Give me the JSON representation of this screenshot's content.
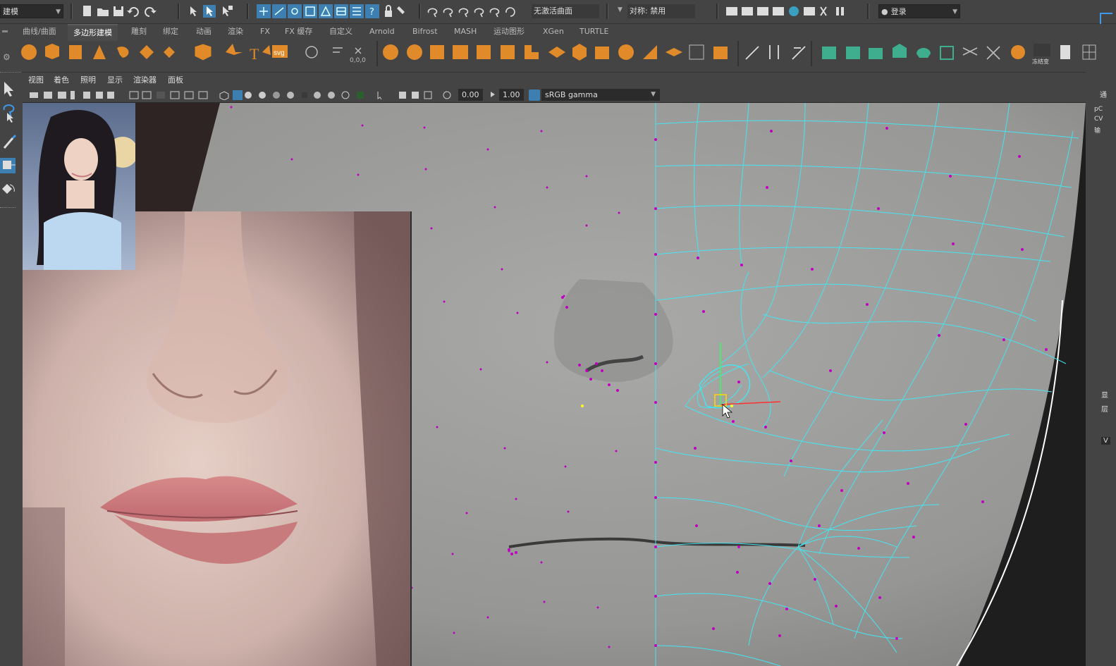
{
  "statusline": {
    "mode": "建模",
    "curve_status": "无激活曲面",
    "symmetry": "对称: 禁用",
    "login": "登录"
  },
  "shelf_tabs": [
    "曲线/曲面",
    "多边形建模",
    "雕刻",
    "绑定",
    "动画",
    "渲染",
    "FX",
    "FX 缓存",
    "自定义",
    "Arnold",
    "Bifrost",
    "MASH",
    "运动图形",
    "XGen",
    "TURTLE"
  ],
  "active_tab_index": 1,
  "shelf": {
    "text_icon": "T",
    "svg_icon": "svg",
    "extra_label": "冻结变"
  },
  "panel_menus": [
    "视图",
    "着色",
    "照明",
    "显示",
    "渲染器",
    "面板"
  ],
  "panel_toolbar": {
    "exposure": "0.00",
    "gamma": "1.00",
    "color_space": "sRGB gamma"
  },
  "right_panel": {
    "labels": [
      "通",
      "pC",
      "CV",
      "输",
      "显",
      "层",
      "V"
    ]
  },
  "icons": {
    "select_tool": "select-arrow-icon",
    "lasso_tool": "lasso-icon",
    "paint_tool": "paint-brush-icon",
    "move_tool": "move-tool-icon",
    "rotate_tool": "rotate-tool-icon"
  },
  "colors": {
    "ui_bg": "#444444",
    "field_bg": "#2b2b2b",
    "shelf_orange": "#e08a2a",
    "shelf_green": "#3fae8e",
    "wireframe_cyan": "#46e4f0",
    "vertex_magenta": "#c000c0",
    "viewport_grey": "#9a9a98"
  }
}
